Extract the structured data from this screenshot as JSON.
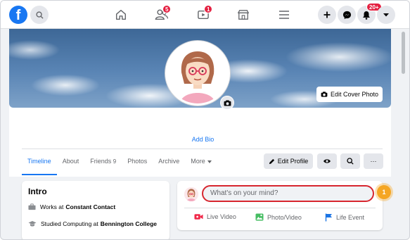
{
  "topbar": {
    "logo_letter": "f",
    "friends_badge": "5",
    "watch_badge": "1",
    "notifications_badge": "20+"
  },
  "profile": {
    "edit_cover_label": "Edit Cover Photo",
    "add_bio_label": "Add Bio"
  },
  "tabs": {
    "timeline": "Timeline",
    "about": "About",
    "friends": "Friends",
    "friends_count": "9",
    "photos": "Photos",
    "archive": "Archive",
    "more": "More"
  },
  "actions": {
    "edit_profile": "Edit Profile",
    "more_dots": "···"
  },
  "intro": {
    "title": "Intro",
    "work_prefix": "Works at",
    "work_place": "Constant Contact",
    "study_prefix": "Studied Computing at",
    "study_place": "Bennington College"
  },
  "composer": {
    "placeholder": "What's on your mind?",
    "live_video": "Live Video",
    "photo_video": "Photo/Video",
    "life_event": "Life Event"
  },
  "callout": {
    "step_number": "1"
  },
  "colors": {
    "brand": "#1877f2",
    "highlight": "#d7262f",
    "callout": "#f5a623"
  }
}
